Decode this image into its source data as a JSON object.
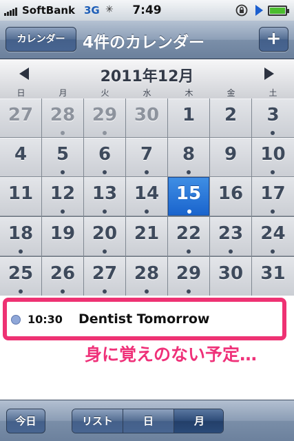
{
  "status_bar": {
    "carrier": "SoftBank",
    "network": "3G",
    "time": "7:49"
  },
  "nav": {
    "back_label": "カレンダー",
    "title": "4件のカレンダー",
    "add_label": "+"
  },
  "month_header": {
    "title": "2011年12月",
    "weekdays": [
      "日",
      "月",
      "火",
      "水",
      "木",
      "金",
      "土"
    ]
  },
  "calendar": {
    "selected_day": "15",
    "weeks": [
      [
        {
          "day": "27",
          "other": true,
          "dot": false
        },
        {
          "day": "28",
          "other": true,
          "dot": true
        },
        {
          "day": "29",
          "other": true,
          "dot": true
        },
        {
          "day": "30",
          "other": true,
          "dot": false
        },
        {
          "day": "1",
          "other": false,
          "dot": false
        },
        {
          "day": "2",
          "other": false,
          "dot": false
        },
        {
          "day": "3",
          "other": false,
          "dot": true
        }
      ],
      [
        {
          "day": "4",
          "other": false,
          "dot": false
        },
        {
          "day": "5",
          "other": false,
          "dot": true
        },
        {
          "day": "6",
          "other": false,
          "dot": true
        },
        {
          "day": "7",
          "other": false,
          "dot": true
        },
        {
          "day": "8",
          "other": false,
          "dot": true
        },
        {
          "day": "9",
          "other": false,
          "dot": false
        },
        {
          "day": "10",
          "other": false,
          "dot": true
        }
      ],
      [
        {
          "day": "11",
          "other": false,
          "dot": false
        },
        {
          "day": "12",
          "other": false,
          "dot": true
        },
        {
          "day": "13",
          "other": false,
          "dot": true
        },
        {
          "day": "14",
          "other": false,
          "dot": true
        },
        {
          "day": "15",
          "other": false,
          "dot": true
        },
        {
          "day": "16",
          "other": false,
          "dot": false
        },
        {
          "day": "17",
          "other": false,
          "dot": true
        }
      ],
      [
        {
          "day": "18",
          "other": false,
          "dot": true
        },
        {
          "day": "19",
          "other": false,
          "dot": false
        },
        {
          "day": "20",
          "other": false,
          "dot": true
        },
        {
          "day": "21",
          "other": false,
          "dot": false
        },
        {
          "day": "22",
          "other": false,
          "dot": true
        },
        {
          "day": "23",
          "other": false,
          "dot": true
        },
        {
          "day": "24",
          "other": false,
          "dot": true
        }
      ],
      [
        {
          "day": "25",
          "other": false,
          "dot": true
        },
        {
          "day": "26",
          "other": false,
          "dot": true
        },
        {
          "day": "27",
          "other": false,
          "dot": true
        },
        {
          "day": "28",
          "other": false,
          "dot": true
        },
        {
          "day": "29",
          "other": false,
          "dot": true
        },
        {
          "day": "30",
          "other": false,
          "dot": false
        },
        {
          "day": "31",
          "other": false,
          "dot": false
        }
      ]
    ]
  },
  "events": [
    {
      "time": "10:30",
      "title": "Dentist Tomorrow",
      "calendar_color": "#8fa7d8"
    }
  ],
  "annotation": "身に覚えのない予定…",
  "toolbar": {
    "today_label": "今日",
    "segments": [
      "リスト",
      "日",
      "月"
    ],
    "active_segment": "月"
  },
  "colors": {
    "highlight_border": "#ee3273",
    "selected_day": "#2a78dc"
  }
}
